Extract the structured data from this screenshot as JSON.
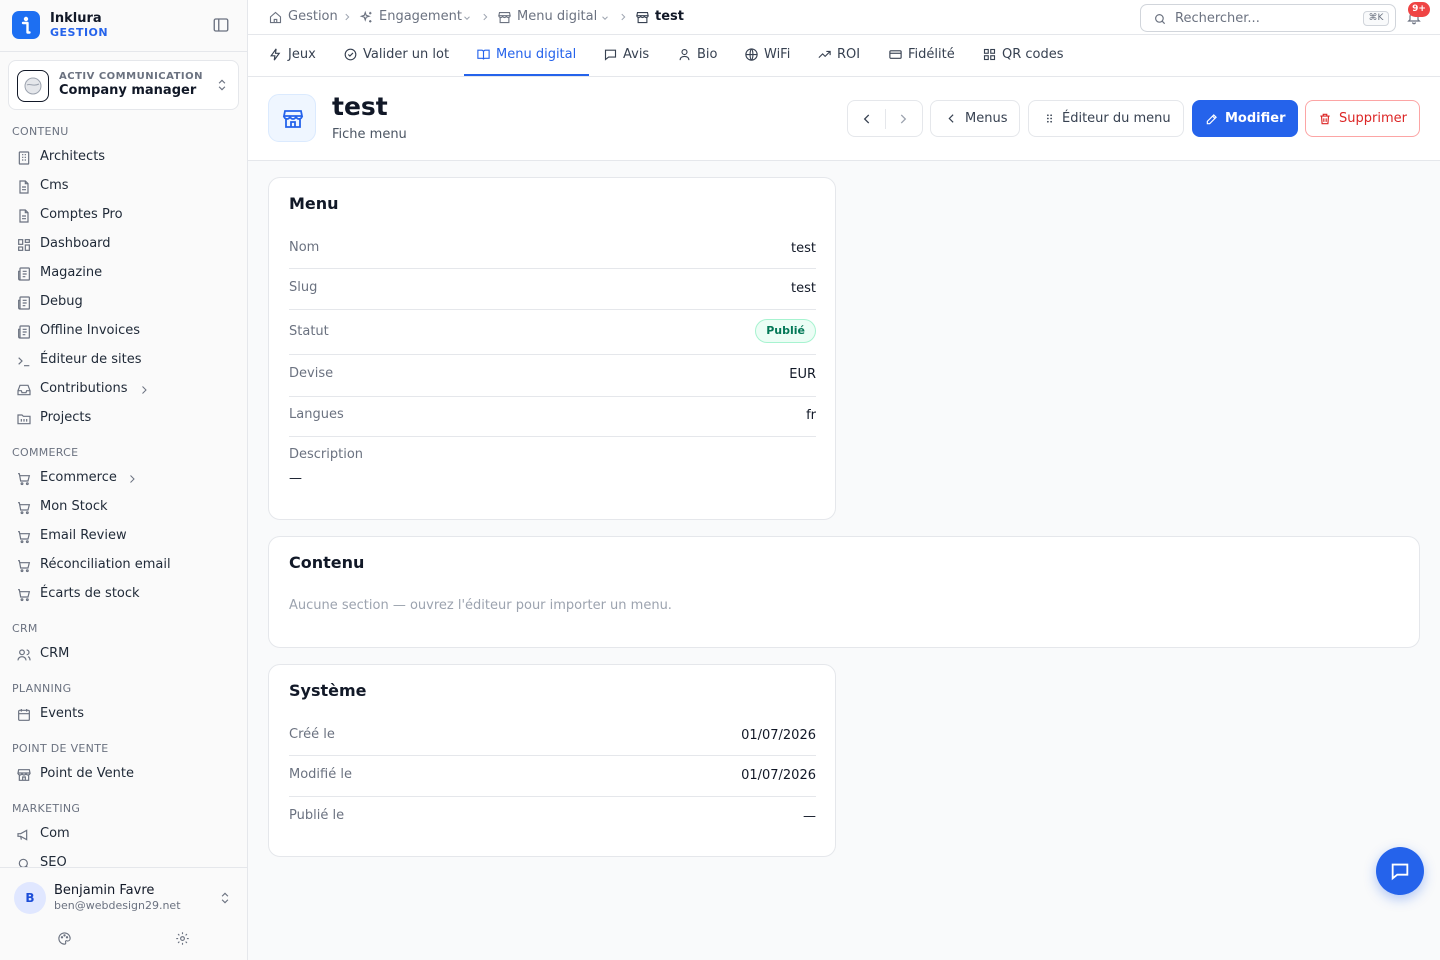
{
  "brand": {
    "name": "Inklura",
    "sub": "GESTION"
  },
  "org": {
    "label": "ACTIV COMMUNICATION",
    "name": "Company manager"
  },
  "sidebar": {
    "sections": [
      {
        "title": "CONTENU",
        "items": [
          {
            "label": "Architects",
            "icon": "building-icon"
          },
          {
            "label": "Cms",
            "icon": "file-icon"
          },
          {
            "label": "Comptes Pro",
            "icon": "file-icon"
          },
          {
            "label": "Dashboard",
            "icon": "grid-icon"
          },
          {
            "label": "Magazine",
            "icon": "newspaper-icon"
          },
          {
            "label": "Debug",
            "icon": "newspaper-icon"
          },
          {
            "label": "Offline Invoices",
            "icon": "newspaper-icon"
          },
          {
            "label": "Éditeur de sites",
            "icon": "terminal-icon"
          },
          {
            "label": "Contributions",
            "icon": "inbox-icon",
            "expandable": true
          },
          {
            "label": "Projects",
            "icon": "folder-icon"
          }
        ]
      },
      {
        "title": "COMMERCE",
        "items": [
          {
            "label": "Ecommerce",
            "icon": "cart-icon",
            "expandable": true
          },
          {
            "label": "Mon Stock",
            "icon": "cart-icon"
          },
          {
            "label": "Email Review",
            "icon": "cart-icon"
          },
          {
            "label": "Réconciliation email",
            "icon": "cart-icon"
          },
          {
            "label": "Écarts de stock",
            "icon": "cart-icon"
          }
        ]
      },
      {
        "title": "CRM",
        "items": [
          {
            "label": "CRM",
            "icon": "users-icon"
          }
        ]
      },
      {
        "title": "PLANNING",
        "items": [
          {
            "label": "Events",
            "icon": "calendar-icon"
          }
        ]
      },
      {
        "title": "POINT DE VENTE",
        "items": [
          {
            "label": "Point de Vente",
            "icon": "store-icon"
          }
        ]
      },
      {
        "title": "MARKETING",
        "items": [
          {
            "label": "Com",
            "icon": "megaphone-icon"
          },
          {
            "label": "SEO",
            "icon": "search-icon"
          }
        ]
      }
    ]
  },
  "user": {
    "initial": "B",
    "name": "Benjamin Favre",
    "email": "ben@webdesign29.net"
  },
  "breadcrumb": [
    {
      "label": "Gestion",
      "icon": "home-icon"
    },
    {
      "label": "Engagement",
      "icon": "sparkles-icon",
      "dropdown": true
    },
    {
      "label": "Menu digital",
      "icon": "store-icon",
      "dropdown": true
    },
    {
      "label": "test",
      "icon": "store-icon",
      "current": true
    }
  ],
  "search": {
    "placeholder": "Rechercher...",
    "shortcut": "⌘K"
  },
  "notifications": {
    "count": "9+"
  },
  "tabs": [
    {
      "label": "Jeux",
      "icon": "zap-icon"
    },
    {
      "label": "Valider un lot",
      "icon": "check-circle-icon"
    },
    {
      "label": "Menu digital",
      "icon": "book-open-icon",
      "active": true
    },
    {
      "label": "Avis",
      "icon": "message-icon"
    },
    {
      "label": "Bio",
      "icon": "user-icon"
    },
    {
      "label": "WiFi",
      "icon": "globe-icon"
    },
    {
      "label": "ROI",
      "icon": "trending-icon"
    },
    {
      "label": "Fidélité",
      "icon": "card-icon"
    },
    {
      "label": "QR codes",
      "icon": "qr-icon"
    }
  ],
  "header": {
    "title": "test",
    "subtitle": "Fiche menu",
    "buttons": {
      "menus": "Menus",
      "editor": "Éditeur du menu",
      "edit": "Modifier",
      "delete": "Supprimer"
    }
  },
  "menu_card": {
    "title": "Menu",
    "rows": [
      {
        "key": "Nom",
        "value": "test"
      },
      {
        "key": "Slug",
        "value": "test"
      },
      {
        "key": "Statut",
        "value": "Publié"
      },
      {
        "key": "Devise",
        "value": "EUR"
      },
      {
        "key": "Langues",
        "value": "fr"
      },
      {
        "key": "Description",
        "value": "—"
      }
    ]
  },
  "content_card": {
    "title": "Contenu",
    "empty": "Aucune section — ouvrez l'éditeur pour importer un menu."
  },
  "system_card": {
    "title": "Système",
    "rows": [
      {
        "key": "Créé le",
        "value": "01/07/2026"
      },
      {
        "key": "Modifié le",
        "value": "01/07/2026"
      },
      {
        "key": "Publié le",
        "value": "—"
      }
    ]
  },
  "colors": {
    "accent": "#2563eb",
    "success": "#047857",
    "danger": "#dc2626",
    "badge": "#ef4444"
  }
}
